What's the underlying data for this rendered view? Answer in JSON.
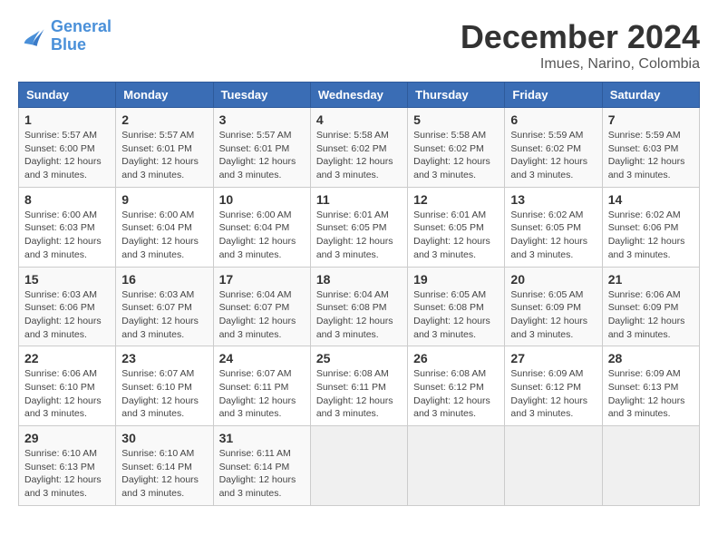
{
  "header": {
    "logo_line1": "General",
    "logo_line2": "Blue",
    "main_title": "December 2024",
    "subtitle": "Imues, Narino, Colombia"
  },
  "days_of_week": [
    "Sunday",
    "Monday",
    "Tuesday",
    "Wednesday",
    "Thursday",
    "Friday",
    "Saturday"
  ],
  "weeks": [
    [
      {
        "day": 1,
        "info": "Sunrise: 5:57 AM\nSunset: 6:00 PM\nDaylight: 12 hours and 3 minutes."
      },
      {
        "day": 2,
        "info": "Sunrise: 5:57 AM\nSunset: 6:01 PM\nDaylight: 12 hours and 3 minutes."
      },
      {
        "day": 3,
        "info": "Sunrise: 5:57 AM\nSunset: 6:01 PM\nDaylight: 12 hours and 3 minutes."
      },
      {
        "day": 4,
        "info": "Sunrise: 5:58 AM\nSunset: 6:02 PM\nDaylight: 12 hours and 3 minutes."
      },
      {
        "day": 5,
        "info": "Sunrise: 5:58 AM\nSunset: 6:02 PM\nDaylight: 12 hours and 3 minutes."
      },
      {
        "day": 6,
        "info": "Sunrise: 5:59 AM\nSunset: 6:02 PM\nDaylight: 12 hours and 3 minutes."
      },
      {
        "day": 7,
        "info": "Sunrise: 5:59 AM\nSunset: 6:03 PM\nDaylight: 12 hours and 3 minutes."
      }
    ],
    [
      {
        "day": 8,
        "info": "Sunrise: 6:00 AM\nSunset: 6:03 PM\nDaylight: 12 hours and 3 minutes."
      },
      {
        "day": 9,
        "info": "Sunrise: 6:00 AM\nSunset: 6:04 PM\nDaylight: 12 hours and 3 minutes."
      },
      {
        "day": 10,
        "info": "Sunrise: 6:00 AM\nSunset: 6:04 PM\nDaylight: 12 hours and 3 minutes."
      },
      {
        "day": 11,
        "info": "Sunrise: 6:01 AM\nSunset: 6:05 PM\nDaylight: 12 hours and 3 minutes."
      },
      {
        "day": 12,
        "info": "Sunrise: 6:01 AM\nSunset: 6:05 PM\nDaylight: 12 hours and 3 minutes."
      },
      {
        "day": 13,
        "info": "Sunrise: 6:02 AM\nSunset: 6:05 PM\nDaylight: 12 hours and 3 minutes."
      },
      {
        "day": 14,
        "info": "Sunrise: 6:02 AM\nSunset: 6:06 PM\nDaylight: 12 hours and 3 minutes."
      }
    ],
    [
      {
        "day": 15,
        "info": "Sunrise: 6:03 AM\nSunset: 6:06 PM\nDaylight: 12 hours and 3 minutes."
      },
      {
        "day": 16,
        "info": "Sunrise: 6:03 AM\nSunset: 6:07 PM\nDaylight: 12 hours and 3 minutes."
      },
      {
        "day": 17,
        "info": "Sunrise: 6:04 AM\nSunset: 6:07 PM\nDaylight: 12 hours and 3 minutes."
      },
      {
        "day": 18,
        "info": "Sunrise: 6:04 AM\nSunset: 6:08 PM\nDaylight: 12 hours and 3 minutes."
      },
      {
        "day": 19,
        "info": "Sunrise: 6:05 AM\nSunset: 6:08 PM\nDaylight: 12 hours and 3 minutes."
      },
      {
        "day": 20,
        "info": "Sunrise: 6:05 AM\nSunset: 6:09 PM\nDaylight: 12 hours and 3 minutes."
      },
      {
        "day": 21,
        "info": "Sunrise: 6:06 AM\nSunset: 6:09 PM\nDaylight: 12 hours and 3 minutes."
      }
    ],
    [
      {
        "day": 22,
        "info": "Sunrise: 6:06 AM\nSunset: 6:10 PM\nDaylight: 12 hours and 3 minutes."
      },
      {
        "day": 23,
        "info": "Sunrise: 6:07 AM\nSunset: 6:10 PM\nDaylight: 12 hours and 3 minutes."
      },
      {
        "day": 24,
        "info": "Sunrise: 6:07 AM\nSunset: 6:11 PM\nDaylight: 12 hours and 3 minutes."
      },
      {
        "day": 25,
        "info": "Sunrise: 6:08 AM\nSunset: 6:11 PM\nDaylight: 12 hours and 3 minutes."
      },
      {
        "day": 26,
        "info": "Sunrise: 6:08 AM\nSunset: 6:12 PM\nDaylight: 12 hours and 3 minutes."
      },
      {
        "day": 27,
        "info": "Sunrise: 6:09 AM\nSunset: 6:12 PM\nDaylight: 12 hours and 3 minutes."
      },
      {
        "day": 28,
        "info": "Sunrise: 6:09 AM\nSunset: 6:13 PM\nDaylight: 12 hours and 3 minutes."
      }
    ],
    [
      {
        "day": 29,
        "info": "Sunrise: 6:10 AM\nSunset: 6:13 PM\nDaylight: 12 hours and 3 minutes."
      },
      {
        "day": 30,
        "info": "Sunrise: 6:10 AM\nSunset: 6:14 PM\nDaylight: 12 hours and 3 minutes."
      },
      {
        "day": 31,
        "info": "Sunrise: 6:11 AM\nSunset: 6:14 PM\nDaylight: 12 hours and 3 minutes."
      },
      null,
      null,
      null,
      null
    ]
  ]
}
